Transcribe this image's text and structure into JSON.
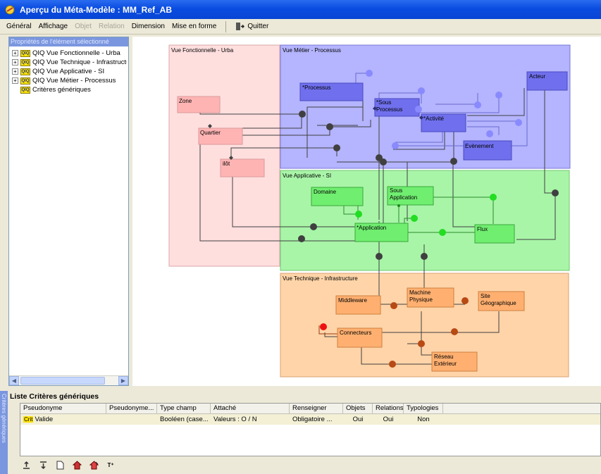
{
  "window": {
    "title": "Aperçu du Méta-Modèle : MM_Ref_AB"
  },
  "menu": {
    "items": [
      "Général",
      "Affichage",
      "Objet",
      "Relation",
      "Dimension",
      "Mise en forme"
    ],
    "disabled": [
      "Objet",
      "Relation"
    ],
    "quit_label": "Quitter"
  },
  "left_panel": {
    "header": "Propriétés de l'élément sélectionné",
    "tree": [
      {
        "label": "QIQ Vue Fonctionnelle - Urba",
        "expandable": true
      },
      {
        "label": "QIQ Vue Technique - Infrastructure",
        "expandable": true
      },
      {
        "label": "QIQ Vue Applicative - SI",
        "expandable": true
      },
      {
        "label": "QIQ Vue Métier - Processus",
        "expandable": true
      },
      {
        "label": "Critères génériques",
        "expandable": false
      }
    ]
  },
  "diagram": {
    "zones": {
      "fonctionnelle": "Vue Fonctionnelle - Urba",
      "metier": "Vue Métier - Processus",
      "applicative": "Vue Applicative - SI",
      "technique": "Vue Technique - Infrastructure"
    },
    "nodes": {
      "zone": "Zone",
      "quartier": "Quartier",
      "ilot": "ilôt",
      "processus": "*Processus",
      "sous_processus_1": "*Sous",
      "sous_processus_2": "Processus",
      "activite": "*Activité",
      "evenement": "Evènement",
      "acteur": "Acteur",
      "domaine": "Domaine",
      "sous_application_1": "Sous",
      "sous_application_2": "Application",
      "application": "*Application",
      "flux": "Flux",
      "middleware": "Middleware",
      "machine_1": "Machine",
      "machine_2": "Physique",
      "site_1": "Site",
      "site_2": "Géographique",
      "connecteurs": "Connecteurs",
      "reseau_1": "Réseau",
      "reseau_2": "Extérieur"
    },
    "colors": {
      "fonctionnelle": "#ffc8c8",
      "metier": "#9a9aff",
      "applicative": "#7fe87f",
      "technique": "#ffc08a"
    }
  },
  "bottom": {
    "side_tab": "Critères génériques",
    "list_title": "Liste Critères génériques",
    "columns": [
      "Pseudonyme",
      "Pseudonyme...",
      "Type champ",
      "Attaché",
      "Renseigner",
      "Objets",
      "Relations",
      "Typologies"
    ],
    "rows": [
      {
        "badge": "Crit",
        "pseudo": "Valide",
        "pseudo2": "",
        "type": "Booléen (case...",
        "attache": "Valeurs : O / N",
        "renseigner": "Obligatoire ...",
        "objets": "Oui",
        "relations": "Oui",
        "typologies": "Non"
      }
    ]
  }
}
